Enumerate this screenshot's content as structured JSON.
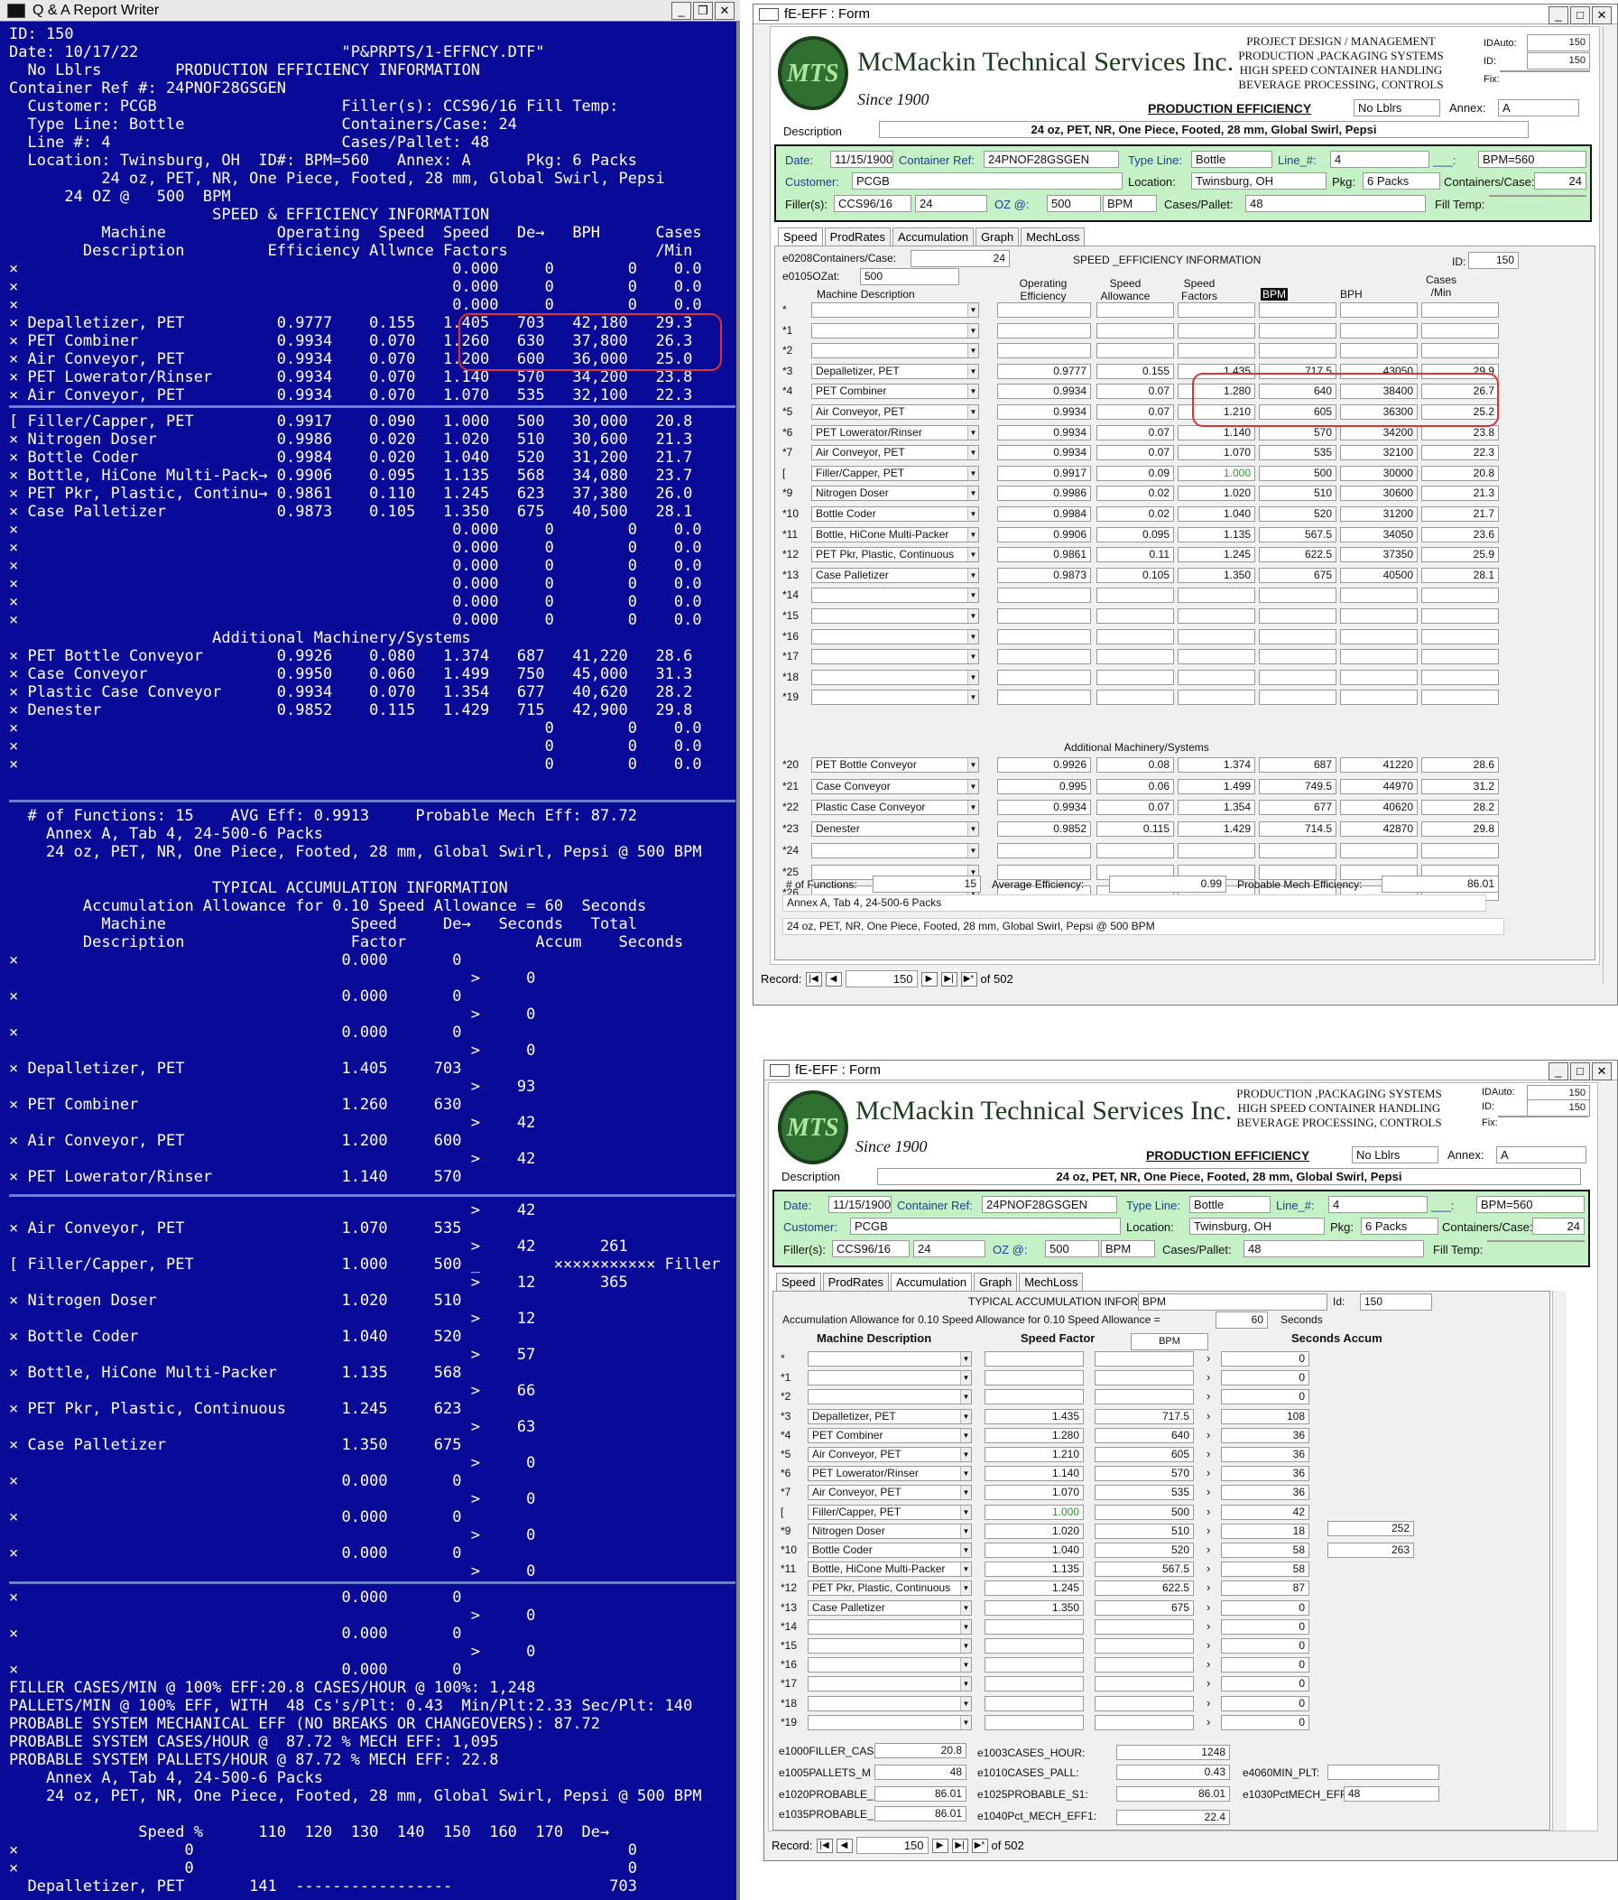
{
  "dos": {
    "title": "Q & A Report Writer",
    "lines": [
      "ID: 150",
      "Date: 10/17/22                      \"P&PRPTS/1-EFFNCY.DTF\"",
      "  No Lblrs        PRODUCTION EFFICIENCY INFORMATION",
      "Container Ref #: 24PNOF28GSGEN",
      "  Customer: PCGB                    Filler(s): CCS96/16 Fill Temp:",
      "  Type Line: Bottle                 Containers/Case: 24",
      "  Line #: 4                         Cases/Pallet: 48",
      "  Location: Twinsburg, OH  ID#: BPM=560   Annex: A      Pkg: 6 Packs",
      "          24 oz, PET, NR, One Piece, Footed, 28 mm, Global Swirl, Pepsi",
      "      24 OZ @   500  BPM",
      "                      SPEED & EFFICIENCY INFORMATION",
      "          Machine            Operating  Speed  Speed   De→   BPH      Cases",
      "        Description         Efficiency Allwnce Factors                /Min",
      "×                                               0.000     0        0    0.0",
      "×                                               0.000     0        0    0.0",
      "×                                               0.000     0        0    0.0",
      "× Depalletizer, PET          0.9777    0.155   1.405   703   42,180   29.3",
      "× PET Combiner               0.9934    0.070   1.260   630   37,800   26.3",
      "× Air Conveyor, PET          0.9934    0.070   1.200   600   36,000   25.0",
      "× PET Lowerator/Rinser       0.9934    0.070   1.140   570   34,200   23.8",
      "× Air Conveyor, PET          0.9934    0.070   1.070   535   32,100   22.3"
    ],
    "lines2": [
      "[ Filler/Capper, PET         0.9917    0.090   1.000   500   30,000   20.8",
      "× Nitrogen Doser             0.9986    0.020   1.020   510   30,600   21.3",
      "× Bottle Coder               0.9984    0.020   1.040   520   31,200   21.7",
      "× Bottle, HiCone Multi-Pack→ 0.9906    0.095   1.135   568   34,080   23.7",
      "× PET Pkr, Plastic, Continu→ 0.9861    0.110   1.245   623   37,380   26.0",
      "× Case Palletizer            0.9873    0.105   1.350   675   40,500   28.1",
      "×                                               0.000     0        0    0.0",
      "×                                               0.000     0        0    0.0",
      "×                                               0.000     0        0    0.0",
      "×                                               0.000     0        0    0.0",
      "×                                               0.000     0        0    0.0",
      "×                                               0.000     0        0    0.0",
      "                      Additional Machinery/Systems",
      "× PET Bottle Conveyor        0.9926    0.080   1.374   687   41,220   28.6",
      "× Case Conveyor              0.9950    0.060   1.499   750   45,000   31.3",
      "× Plastic Case Conveyor      0.9934    0.070   1.354   677   40,620   28.2",
      "× Denester                   0.9852    0.115   1.429   715   42,900   29.8",
      "×                                                         0        0    0.0",
      "×                                                         0        0    0.0",
      "×                                                         0        0    0.0"
    ],
    "lines3": [
      "  # of Functions: 15    AVG Eff: 0.9913     Probable Mech Eff: 87.72",
      "    Annex A, Tab 4, 24-500-6 Packs",
      "    24 oz, PET, NR, One Piece, Footed, 28 mm, Global Swirl, Pepsi @ 500 BPM",
      "",
      "                      TYPICAL ACCUMULATION INFORMATION",
      "        Accumulation Allowance for 0.10 Speed Allowance = 60  Seconds",
      "          Machine                    Speed     De→   Seconds   Total",
      "        Description                  Factor              Accum    Seconds",
      "×                                   0.000       0",
      "                                                  >     0",
      "×                                   0.000       0",
      "                                                  >     0",
      "×                                   0.000       0",
      "                                                  >     0",
      "× Depalletizer, PET                 1.405     703",
      "                                                  >    93",
      "× PET Combiner                      1.260     630",
      "                                                  >    42",
      "× Air Conveyor, PET                 1.200     600",
      "                                                  >    42",
      "× PET Lowerator/Rinser              1.140     570"
    ],
    "lines4": [
      "                                                  >    42",
      "× Air Conveyor, PET                 1.070     535",
      "                                                  >    42       261",
      "[ Filler/Capper, PET                1.000     500 _        ××××××××××× Filler",
      "                                                  >    12       365",
      "× Nitrogen Doser                    1.020     510",
      "                                                  >    12",
      "× Bottle Coder                      1.040     520",
      "                                                  >    57",
      "× Bottle, HiCone Multi-Packer       1.135     568",
      "                                                  >    66",
      "× PET Pkr, Plastic, Continuous      1.245     623",
      "                                                  >    63",
      "× Case Palletizer                   1.350     675",
      "                                                  >     0",
      "×                                   0.000       0",
      "                                                  >     0",
      "×                                   0.000       0",
      "                                                  >     0",
      "×                                   0.000       0",
      "                                                  >     0"
    ],
    "lines5": [
      "×                                   0.000       0",
      "                                                  >     0",
      "×                                   0.000       0",
      "                                                  >     0",
      "×                                   0.000       0",
      "FILLER CASES/MIN @ 100% EFF:20.8 CASES/HOUR @ 100%: 1,248",
      "PALLETS/MIN @ 100% EFF, WITH  48 Cs's/Plt: 0.43  Min/Plt:2.33 Sec/Plt: 140",
      "PROBABLE SYSTEM MECHANICAL EFF (NO BREAKS OR CHANGEOVERS): 87.72",
      "PROBABLE SYSTEM CASES/HOUR @  87.72 % MECH EFF: 1,095",
      "PROBABLE SYSTEM PALLETS/HOUR @ 87.72 % MECH EFF: 22.8",
      "    Annex A, Tab 4, 24-500-6 Packs",
      "    24 oz, PET, NR, One Piece, Footed, 28 mm, Global Swirl, Pepsi @ 500 BPM",
      "",
      "              Speed %      110  120  130  140  150  160  170  De→",
      "×                  0                                               0",
      "×                  0                                               0",
      "  Depalletizer, PET       141  -----------------                 703"
    ]
  },
  "form1": {
    "title": "fE-EFF : Form",
    "company": "McMackin Technical Services Inc.",
    "logo": "MTS",
    "since": "Since 1900",
    "pd_lines": [
      "PROJECT DESIGN / MANAGEMENT",
      "PRODUCTION ,PACKAGING SYSTEMS",
      "HIGH SPEED CONTAINER HANDLING",
      "BEVERAGE PROCESSING, CONTROLS"
    ],
    "idauto_label": "IDAuto:",
    "idauto": "150",
    "id_label": "ID:",
    "id": "150",
    "fix_label": "Fix:",
    "prod_eff": "PRODUCTION EFFICIENCY",
    "nolblrs": "No Lblrs",
    "annex_label": "Annex:",
    "annex": "A",
    "desc_label": "Description",
    "desc": "24 oz, PET, NR, One Piece, Footed, 28 mm, Global Swirl, Pepsi",
    "date_label": "Date:",
    "date": "11/15/1900",
    "cref_label": "Container Ref:",
    "cref": "24PNOF28GSGEN",
    "tl_label": "Type Line:",
    "tl": "Bottle",
    "line_label": "Line_#:",
    "line": "4",
    "bpm_label": "___:",
    "bpm": "BPM=560",
    "cust_label": "Customer:",
    "cust": "PCGB",
    "loc_label": "Location:",
    "loc": "Twinsburg, OH",
    "pkg_label": "Pkg:",
    "pkg": "6 Packs",
    "cpc_label": "Containers/Case:",
    "cpc": "24",
    "filler_label": "Filler(s):",
    "filler": "CCS96/16",
    "f24": "24",
    "oz_label": "OZ @:",
    "oz": "500",
    "bpmunit": "BPM",
    "cpp_label": "Cases/Pallet:",
    "cpp": "48",
    "ft_label": "Fill Temp:",
    "tabs": [
      "Speed",
      "ProdRates",
      "Accumulation",
      "Graph",
      "MechLoss"
    ],
    "e0208": "e0208Containers/Case:",
    "e0208v": "24",
    "e0105": "e0105OZat:",
    "e0105v": "500",
    "sei": "SPEED _EFFICIENCY INFORMATION",
    "id2_label": "ID:",
    "id2": "150",
    "col_md": "Machine Description",
    "col_oe": "Operating Efficiency",
    "col_sa": "Speed Allowance",
    "col_sf": "Speed Factors",
    "col_bpm": "BPM",
    "col_bph": "BPH",
    "col_cpm": "Cases /Min",
    "rows": [
      {
        "n": "*",
        "m": "",
        "oe": "",
        "sa": "",
        "sf": "",
        "bpm": "",
        "bph": "",
        "cpm": ""
      },
      {
        "n": "*1",
        "m": "",
        "oe": "",
        "sa": "",
        "sf": "",
        "bpm": "",
        "bph": "",
        "cpm": ""
      },
      {
        "n": "*2",
        "m": "",
        "oe": "",
        "sa": "",
        "sf": "",
        "bpm": "",
        "bph": "",
        "cpm": ""
      },
      {
        "n": "*3",
        "m": "Depalletizer, PET",
        "oe": "0.9777",
        "sa": "0.155",
        "sf": "1.435",
        "bpm": "717.5",
        "bph": "43050",
        "cpm": "29.9"
      },
      {
        "n": "*4",
        "m": "PET Combiner",
        "oe": "0.9934",
        "sa": "0.07",
        "sf": "1.280",
        "bpm": "640",
        "bph": "38400",
        "cpm": "26.7"
      },
      {
        "n": "*5",
        "m": "Air Conveyor, PET",
        "oe": "0.9934",
        "sa": "0.07",
        "sf": "1.210",
        "bpm": "605",
        "bph": "36300",
        "cpm": "25.2"
      },
      {
        "n": "*6",
        "m": "PET Lowerator/Rinser",
        "oe": "0.9934",
        "sa": "0.07",
        "sf": "1.140",
        "bpm": "570",
        "bph": "34200",
        "cpm": "23.8"
      },
      {
        "n": "*7",
        "m": "Air Conveyor, PET",
        "oe": "0.9934",
        "sa": "0.07",
        "sf": "1.070",
        "bpm": "535",
        "bph": "32100",
        "cpm": "22.3"
      },
      {
        "n": "[",
        "m": "Filler/Capper, PET",
        "oe": "0.9917",
        "sa": "0.09",
        "sf": "1.000",
        "bpm": "500",
        "bph": "30000",
        "cpm": "20.8"
      },
      {
        "n": "*9",
        "m": "Nitrogen Doser",
        "oe": "0.9986",
        "sa": "0.02",
        "sf": "1.020",
        "bpm": "510",
        "bph": "30600",
        "cpm": "21.3"
      },
      {
        "n": "*10",
        "m": "Bottle Coder",
        "oe": "0.9984",
        "sa": "0.02",
        "sf": "1.040",
        "bpm": "520",
        "bph": "31200",
        "cpm": "21.7"
      },
      {
        "n": "*11",
        "m": "Bottle, HiCone Multi-Packer",
        "oe": "0.9906",
        "sa": "0.095",
        "sf": "1.135",
        "bpm": "567.5",
        "bph": "34050",
        "cpm": "23.6"
      },
      {
        "n": "*12",
        "m": "PET Pkr, Plastic, Continuous",
        "oe": "0.9861",
        "sa": "0.11",
        "sf": "1.245",
        "bpm": "622.5",
        "bph": "37350",
        "cpm": "25.9"
      },
      {
        "n": "*13",
        "m": "Case Palletizer",
        "oe": "0.9873",
        "sa": "0.105",
        "sf": "1.350",
        "bpm": "675",
        "bph": "40500",
        "cpm": "28.1"
      },
      {
        "n": "*14",
        "m": "",
        "oe": "",
        "sa": "",
        "sf": "",
        "bpm": "",
        "bph": "",
        "cpm": ""
      },
      {
        "n": "*15",
        "m": "",
        "oe": "",
        "sa": "",
        "sf": "",
        "bpm": "",
        "bph": "",
        "cpm": ""
      },
      {
        "n": "*16",
        "m": "",
        "oe": "",
        "sa": "",
        "sf": "",
        "bpm": "",
        "bph": "",
        "cpm": ""
      },
      {
        "n": "*17",
        "m": "",
        "oe": "",
        "sa": "",
        "sf": "",
        "bpm": "",
        "bph": "",
        "cpm": ""
      },
      {
        "n": "*18",
        "m": "",
        "oe": "",
        "sa": "",
        "sf": "",
        "bpm": "",
        "bph": "",
        "cpm": ""
      },
      {
        "n": "*19",
        "m": "",
        "oe": "",
        "sa": "",
        "sf": "",
        "bpm": "",
        "bph": "",
        "cpm": ""
      }
    ],
    "addl": "Additional Machinery/Systems",
    "rows2": [
      {
        "n": "*20",
        "m": "PET Bottle Conveyor",
        "oe": "0.9926",
        "sa": "0.08",
        "sf": "1.374",
        "bpm": "687",
        "bph": "41220",
        "cpm": "28.6"
      },
      {
        "n": "*21",
        "m": "Case Conveyor",
        "oe": "0.995",
        "sa": "0.06",
        "sf": "1.499",
        "bpm": "749.5",
        "bph": "44970",
        "cpm": "31.2"
      },
      {
        "n": "*22",
        "m": "Plastic Case Conveyor",
        "oe": "0.9934",
        "sa": "0.07",
        "sf": "1.354",
        "bpm": "677",
        "bph": "40620",
        "cpm": "28.2"
      },
      {
        "n": "*23",
        "m": "Denester",
        "oe": "0.9852",
        "sa": "0.115",
        "sf": "1.429",
        "bpm": "714.5",
        "bph": "42870",
        "cpm": "29.8"
      },
      {
        "n": "*24",
        "m": "",
        "oe": "",
        "sa": "",
        "sf": "",
        "bpm": "",
        "bph": "",
        "cpm": ""
      },
      {
        "n": "*25",
        "m": "",
        "oe": "",
        "sa": "",
        "sf": "",
        "bpm": "",
        "bph": "",
        "cpm": ""
      },
      {
        "n": "*26",
        "m": "",
        "oe": "",
        "sa": "",
        "sf": "",
        "bpm": "",
        "bph": "",
        "cpm": ""
      }
    ],
    "nf_label": "# of Functions:",
    "nf": "15",
    "ae_label": "Average Efficiency:",
    "ae": "0.99",
    "pme_label": "Probable Mech Efficiency:",
    "pme": "86.01",
    "annex_line": "Annex A, Tab 4, 24-500-6 Packs",
    "desc_line": "24 oz, PET, NR, One Piece, Footed, 28 mm, Global Swirl, Pepsi @ 500 BPM",
    "rec_label": "Record:",
    "rec": "150",
    "of": "of 502"
  },
  "form2": {
    "title": "fE-EFF : Form",
    "tabs": [
      "Speed",
      "ProdRates",
      "Accumulation",
      "Graph",
      "MechLoss"
    ],
    "tai": "TYPICAL ACCUMULATION INFORMATION",
    "bpm": "BPM",
    "id_label": "Id:",
    "id": "150",
    "aa": "Accumulation Allowance for 0.10 Speed Allowance for 0.10 Speed Allowance =",
    "aav": "60",
    "sec": "Seconds",
    "col_md": "Machine Description",
    "col_sf": "Speed Factor",
    "col_bpm": "BPM",
    "col_sa": "Seconds Accum",
    "rows": [
      {
        "n": "*",
        "m": "",
        "sf": "",
        "bpm": "",
        "acc": "0"
      },
      {
        "n": "*1",
        "m": "",
        "sf": "",
        "bpm": "",
        "acc": "0"
      },
      {
        "n": "*2",
        "m": "",
        "sf": "",
        "bpm": "",
        "acc": "0"
      },
      {
        "n": "*3",
        "m": "Depalletizer, PET",
        "sf": "1.435",
        "bpm": "717.5",
        "acc": "108"
      },
      {
        "n": "*4",
        "m": "PET Combiner",
        "sf": "1.280",
        "bpm": "640",
        "acc": "36"
      },
      {
        "n": "*5",
        "m": "Air Conveyor, PET",
        "sf": "1.210",
        "bpm": "605",
        "acc": "36"
      },
      {
        "n": "*6",
        "m": "PET Lowerator/Rinser",
        "sf": "1.140",
        "bpm": "570",
        "acc": "36"
      },
      {
        "n": "*7",
        "m": "Air Conveyor, PET",
        "sf": "1.070",
        "bpm": "535",
        "acc": "36"
      },
      {
        "n": "[",
        "m": "Filler/Capper, PET",
        "sf": "1.000",
        "bpm": "500",
        "acc": "42"
      },
      {
        "n": "*9",
        "m": "Nitrogen Doser",
        "sf": "1.020",
        "bpm": "510",
        "acc": "18"
      },
      {
        "n": "*10",
        "m": "Bottle Coder",
        "sf": "1.040",
        "bpm": "520",
        "acc": "58"
      },
      {
        "n": "*11",
        "m": "Bottle, HiCone Multi-Packer",
        "sf": "1.135",
        "bpm": "567.5",
        "acc": "58"
      },
      {
        "n": "*12",
        "m": "PET Pkr, Plastic, Continuous",
        "sf": "1.245",
        "bpm": "622.5",
        "acc": "87"
      },
      {
        "n": "*13",
        "m": "Case Palletizer",
        "sf": "1.350",
        "bpm": "675",
        "acc": "0"
      },
      {
        "n": "*14",
        "m": "",
        "sf": "",
        "bpm": "",
        "acc": "0"
      },
      {
        "n": "*15",
        "m": "",
        "sf": "",
        "bpm": "",
        "acc": "0"
      },
      {
        "n": "*16",
        "m": "",
        "sf": "",
        "bpm": "",
        "acc": "0"
      },
      {
        "n": "*17",
        "m": "",
        "sf": "",
        "bpm": "",
        "acc": "0"
      },
      {
        "n": "*18",
        "m": "",
        "sf": "",
        "bpm": "",
        "acc": "0"
      },
      {
        "n": "*19",
        "m": "",
        "sf": "",
        "bpm": "",
        "acc": "0"
      }
    ],
    "tot1": "252",
    "tot2": "263",
    "e1000": "e1000FILLER_CAS",
    "e1000v": "20.8",
    "e1003": "e1003CASES_HOUR:",
    "e1003v": "1248",
    "e1005": "e1005PALLETS_M",
    "e1005v": "48",
    "e1010": "e1010CASES_PALL:",
    "e1010v": "0.43",
    "e4060": "e4060MIN_PLT:",
    "e1020": "e1020PROBABLE_",
    "e1020v": "86.01",
    "e1025": "e1025PROBABLE_S1:",
    "e1025v": "86.01",
    "e1030": "e1030PctMECH_EFF:",
    "e1030v": "48",
    "e1035": "e1035PROBABLE_",
    "e1035v": "86.01",
    "e1040": "e1040Pct_MECH_EFF1:",
    "e1040v": "22.4",
    "rec_label": "Record:",
    "rec": "150",
    "of": "of 502"
  }
}
